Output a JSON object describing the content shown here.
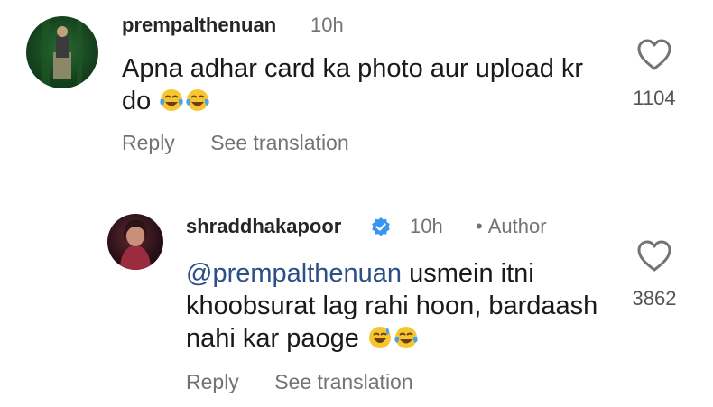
{
  "comments": [
    {
      "username": "prempalthenuan",
      "time": "10h",
      "text": "Apna adhar card ka photo aur upload kr do",
      "like_count": "1104",
      "reply_label": "Reply",
      "translate_label": "See translation",
      "emojis": [
        "face-with-tears-of-joy",
        "face-with-tears-of-joy"
      ]
    },
    {
      "username": "shraddhakapoor",
      "verified": true,
      "time": "10h",
      "author_dot": "•",
      "author_label": "Author",
      "mention": "@prempalthenuan",
      "text": "usmein itni khoobsurat lag rahi hoon, bardaash nahi kar paoge",
      "like_count": "3862",
      "reply_label": "Reply",
      "translate_label": "See translation",
      "emojis": [
        "grinning-face-with-sweat",
        "face-with-tears-of-joy"
      ]
    }
  ],
  "colors": {
    "username": "#262626",
    "secondary": "#737373",
    "mention": "#2b4f86",
    "verified": "#3797f0"
  }
}
